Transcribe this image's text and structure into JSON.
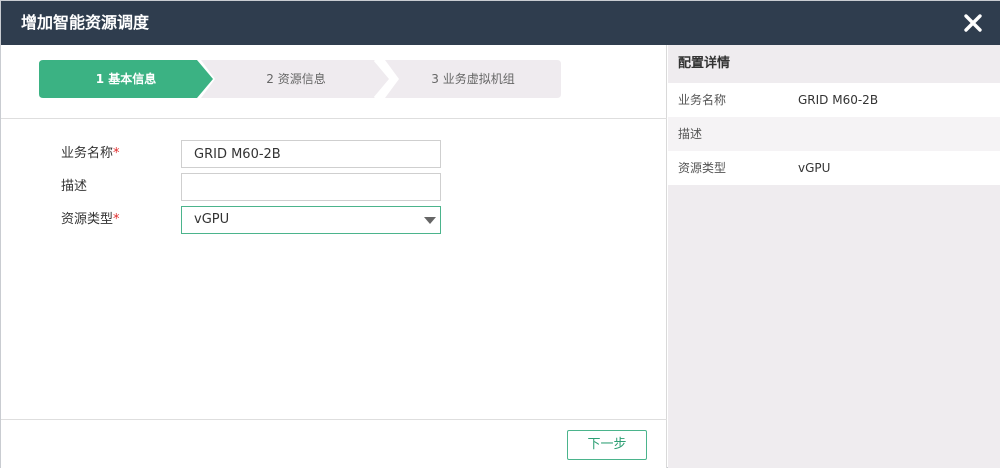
{
  "dialog": {
    "title": "增加智能资源调度"
  },
  "steps": [
    {
      "label": "1 基本信息",
      "active": true
    },
    {
      "label": "2 资源信息",
      "active": false
    },
    {
      "label": "3 业务虚拟机组",
      "active": false
    }
  ],
  "form": {
    "name_label": "业务名称",
    "name_value": "GRID M60-2B",
    "desc_label": "描述",
    "desc_value": "",
    "type_label": "资源类型",
    "type_value": "vGPU",
    "required_mark": "*"
  },
  "footer": {
    "next_label": "下一步"
  },
  "summary": {
    "title": "配置详情",
    "rows": [
      {
        "key": "业务名称",
        "value": "GRID M60-2B"
      },
      {
        "key": "描述",
        "value": ""
      },
      {
        "key": "资源类型",
        "value": "vGPU"
      }
    ]
  },
  "colors": {
    "titlebar": "#2f3d4e",
    "accent": "#3bb283",
    "step_inactive": "#efebef",
    "required": "#e02a2a"
  },
  "icons": {
    "close": "close-icon",
    "dropdown": "caret-down-icon"
  }
}
